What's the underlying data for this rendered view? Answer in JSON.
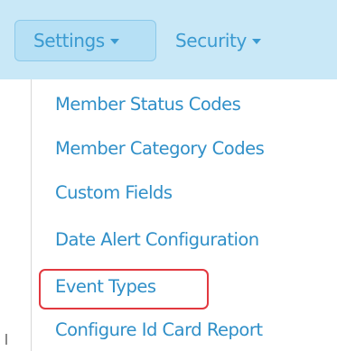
{
  "navbar": {
    "settings_label": "Settings",
    "security_label": "Security",
    "settings_caret_icon": "caret-down-icon",
    "security_caret_icon": "caret-down-icon"
  },
  "settings_menu": {
    "items": [
      {
        "label": "Member Status Codes"
      },
      {
        "label": "Member Category Codes"
      },
      {
        "label": "Custom Fields"
      },
      {
        "label": "Date Alert Configuration"
      },
      {
        "label": "Event Types",
        "highlighted": true
      },
      {
        "label": "Configure Id Card Report"
      }
    ]
  },
  "colors": {
    "navbar_background": "#c9e8f7",
    "active_nav_background": "#b6e0f5",
    "link_color": "#2f8fc8",
    "highlight_border": "#e2383f"
  }
}
